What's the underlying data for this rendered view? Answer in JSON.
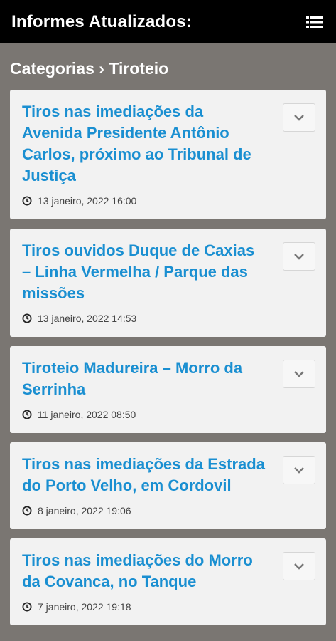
{
  "header": {
    "title": "Informes Atualizados:",
    "menu_icon": "menu-icon"
  },
  "breadcrumb": {
    "text": "Categorias › Tiroteio"
  },
  "posts": [
    {
      "title": "Tiros nas imediações da Avenida Presidente Antônio Carlos, próximo ao Tribunal de Justiça",
      "date": "13 janeiro, 2022 16:00"
    },
    {
      "title": "Tiros ouvidos Duque de Caxias – Linha Vermelha / Parque das missões",
      "date": "13 janeiro, 2022 14:53"
    },
    {
      "title": "Tiroteio Madureira – Morro da Serrinha",
      "date": "11 janeiro, 2022 08:50"
    },
    {
      "title": "Tiros nas imediações da Estrada do Porto Velho, em Cordovil",
      "date": "8 janeiro, 2022 19:06"
    },
    {
      "title": "Tiros nas imediações do Morro da Covanca, no Tanque",
      "date": "7 janeiro, 2022 19:18"
    }
  ],
  "colors": {
    "link": "#1a8fd1",
    "header_bg": "#000000",
    "page_bg": "#7a7672",
    "card_bg": "#f2f2f2"
  }
}
